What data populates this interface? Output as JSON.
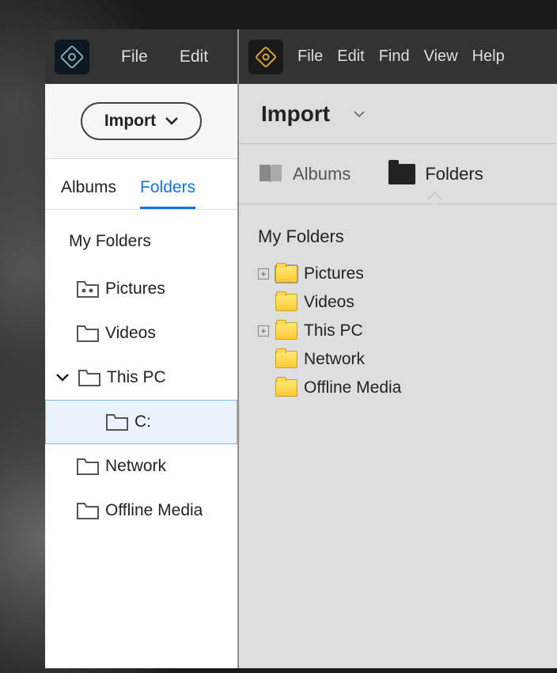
{
  "left": {
    "menu": {
      "file": "File",
      "edit": "Edit"
    },
    "import_button": "Import",
    "tabs": {
      "albums": "Albums",
      "folders": "Folders"
    },
    "section": "My Folders",
    "items": {
      "pictures": "Pictures",
      "videos": "Videos",
      "thispc": "This PC",
      "c": "C:",
      "network": "Network",
      "offline": "Offline Media"
    }
  },
  "right": {
    "menu": {
      "file": "File",
      "edit": "Edit",
      "find": "Find",
      "view": "View",
      "help": "Help"
    },
    "header": "Import",
    "tabs": {
      "albums": "Albums",
      "folders": "Folders"
    },
    "section": "My Folders",
    "items": {
      "pictures": "Pictures",
      "videos": "Videos",
      "thispc": "This PC",
      "network": "Network",
      "offline": "Offline Media"
    }
  }
}
